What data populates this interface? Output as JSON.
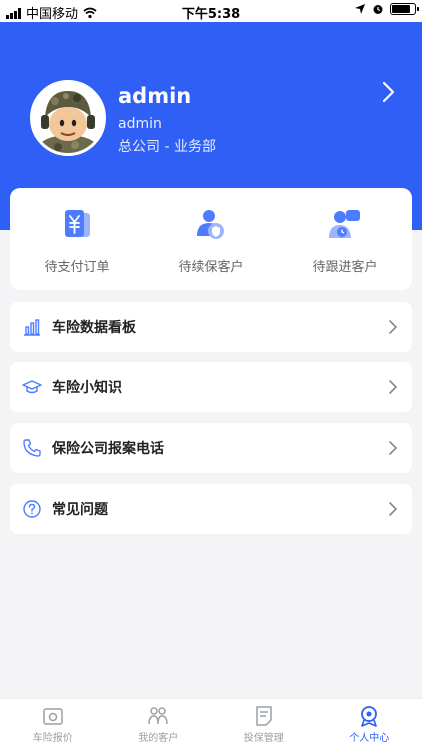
{
  "status_bar": {
    "carrier": "中国移动",
    "time": "下午5:38"
  },
  "profile": {
    "username": "admin",
    "role": "admin",
    "department": "总公司 - 业务部"
  },
  "quick_actions": [
    {
      "label": "待支付订单",
      "icon": "yen-card-icon"
    },
    {
      "label": "待续保客户",
      "icon": "renewal-user-icon"
    },
    {
      "label": "待跟进客户",
      "icon": "followup-user-icon"
    }
  ],
  "menu": [
    {
      "label": "车险数据看板",
      "icon": "bar-chart-icon"
    },
    {
      "label": "车险小知识",
      "icon": "graduation-cap-icon"
    },
    {
      "label": "保险公司报案电话",
      "icon": "phone-icon"
    },
    {
      "label": "常见问题",
      "icon": "question-icon"
    }
  ],
  "tabs": [
    {
      "label": "车险报价",
      "icon": "camera-icon"
    },
    {
      "label": "我的客户",
      "icon": "users-icon"
    },
    {
      "label": "投保管理",
      "icon": "document-icon"
    },
    {
      "label": "个人中心",
      "icon": "profile-icon"
    }
  ],
  "colors": {
    "primary": "#2f5ff5",
    "background": "#f4f4f6",
    "icon_blue": "#4d7cff"
  }
}
